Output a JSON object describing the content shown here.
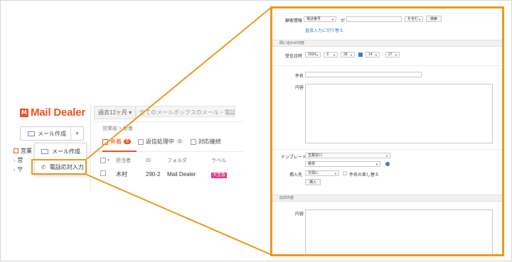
{
  "colors": {
    "accent": "#e8541e",
    "callout": "#e99b1c",
    "link": "#3a7bd5",
    "label_red": "#e8368f"
  },
  "app": {
    "logo_mark": "M",
    "logo_text": "Mail Dealer",
    "period": "過去12ヶ月",
    "search_placeholder": "全てのメールボックスのメール・電話を検索",
    "breadcrumb": "営業部 > 新着",
    "mail_create": "メール作成",
    "tree": [
      "営業",
      "営",
      "サ"
    ]
  },
  "dropdown": {
    "items": [
      {
        "label": "メール作成",
        "icon": "envelope-icon"
      },
      {
        "label": "電話応対入力",
        "icon": "phone-icon"
      }
    ]
  },
  "tabs": [
    {
      "label": "新着",
      "count": "6",
      "active": true
    },
    {
      "label": "返信処理中",
      "count": "0",
      "active": false
    },
    {
      "label": "対応継続",
      "count": "",
      "active": false
    }
  ],
  "table": {
    "headers": [
      "担当者",
      "ID",
      "フォルダ",
      "ラベル"
    ],
    "rows": [
      {
        "owner": "木村",
        "id": "290-2",
        "folder": "Mail Dealer",
        "label": "大至急"
      }
    ]
  },
  "form": {
    "customer_label": "顧客情報",
    "customer_field": "電話番号",
    "customer_op": "が",
    "customer_match": "を含む",
    "search_button": "検索",
    "switch_link": "直接入力に切り替え",
    "inquiry_section": "問い合わせ内容",
    "received_label": "受信日時",
    "year": "2024",
    "month": "3",
    "day": "28",
    "hour": "14",
    "minute": "27",
    "time_sep": ":",
    "subject_label": "件名",
    "content_label": "内容",
    "template_label": "テンプレート",
    "template_value": "営業窓口",
    "template_sub": "挨拶",
    "insert_label": "挿入先",
    "insert_value": "文頭に",
    "replace_subject": "件名の差し替え",
    "insert_button": "挿入",
    "response_section": "応対内容",
    "response_content_label": "内容"
  }
}
